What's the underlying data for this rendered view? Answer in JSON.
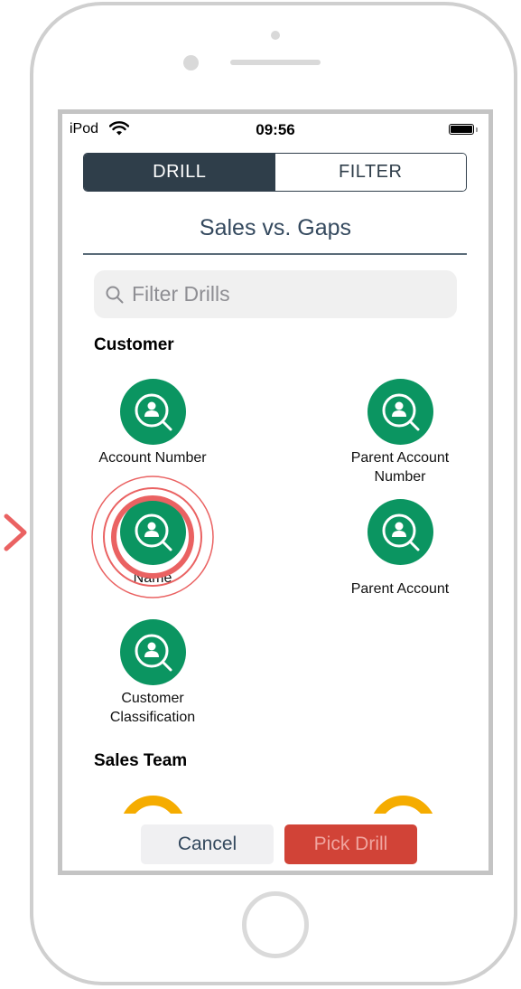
{
  "status_bar": {
    "carrier": "iPod",
    "time": "09:56"
  },
  "segmented_control": {
    "tabs": [
      {
        "label": "DRILL",
        "active": true
      },
      {
        "label": "FILTER",
        "active": false
      }
    ]
  },
  "title": "Sales vs. Gaps",
  "search": {
    "placeholder": "Filter Drills",
    "value": ""
  },
  "sections": [
    {
      "header": "Customer",
      "items": [
        {
          "label": "Account Number",
          "icon": "user-search-icon"
        },
        {
          "label": "Parent Account Number",
          "icon": "user-search-icon"
        },
        {
          "label": "Name",
          "icon": "user-search-icon",
          "highlighted": true
        },
        {
          "label": "Parent Account",
          "icon": "user-search-icon"
        },
        {
          "label": "Customer Classification",
          "icon": "user-search-icon"
        }
      ]
    },
    {
      "header": "Sales Team",
      "items": []
    }
  ],
  "buttons": {
    "cancel": "Cancel",
    "pick": "Pick Drill"
  },
  "colors": {
    "primary_dark": "#2f3e4a",
    "drill_green": "#0b9561",
    "sales_team_yellow": "#f5ac00",
    "accent_red": "#d14337",
    "tap_highlight": "#ea6262"
  }
}
